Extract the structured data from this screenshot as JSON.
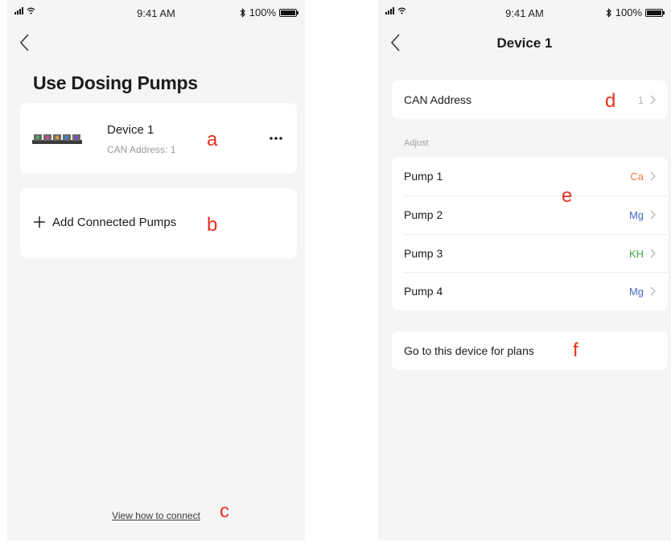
{
  "status_bar": {
    "time": "9:41 AM",
    "battery": "100%"
  },
  "left_screen": {
    "title": "Use Dosing Pumps",
    "device": {
      "name": "Device 1",
      "can_address": "CAN Address: 1"
    },
    "add_label": "Add Connected Pumps",
    "help_link": "View how to connect",
    "annotations": {
      "device": "a",
      "add": "b",
      "help": "c"
    }
  },
  "right_screen": {
    "title": "Device 1",
    "can_address": {
      "label": "CAN Address",
      "value": "1"
    },
    "section_label": "Adjust",
    "pumps": [
      {
        "label": "Pump 1",
        "value": "Ca",
        "color": "#e07b45"
      },
      {
        "label": "Pump 2",
        "value": "Mg",
        "color": "#4a6bc4"
      },
      {
        "label": "Pump 3",
        "value": "KH",
        "color": "#3ea64a"
      },
      {
        "label": "Pump 4",
        "value": "Mg",
        "color": "#4a6bc4"
      }
    ],
    "plans_label": "Go to this device for plans",
    "annotations": {
      "can": "d",
      "pumps": "e",
      "plans": "f"
    }
  },
  "icons": [
    "signal-icon",
    "wifi-icon",
    "bluetooth-icon",
    "battery-icon",
    "back-chevron-icon",
    "more-icon",
    "plus-icon",
    "chevron-right-icon"
  ],
  "colors": {
    "annotation": "#e5321e",
    "background": "#f5f5f6",
    "card": "#ffffff"
  }
}
